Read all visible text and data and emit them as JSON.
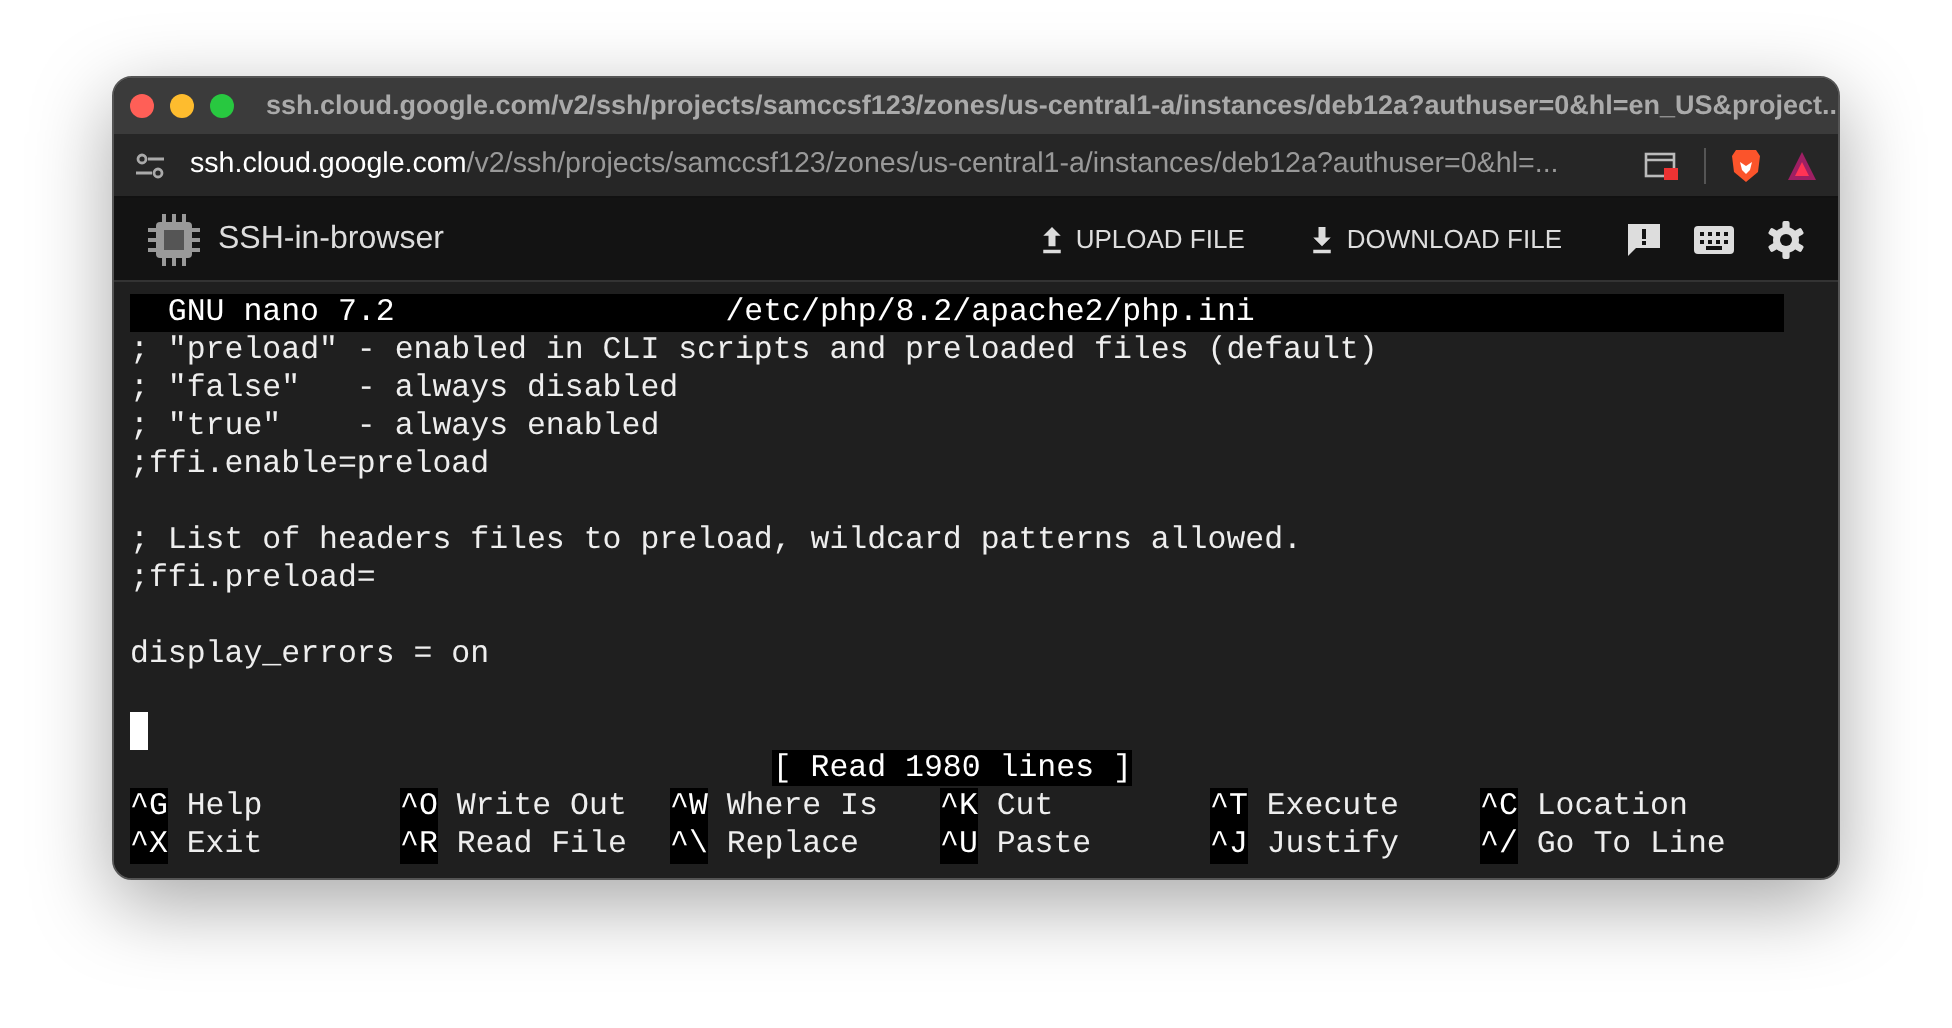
{
  "window": {
    "title": "ssh.cloud.google.com/v2/ssh/projects/samccsf123/zones/us-central1-a/instances/deb12a?authuser=0&hl=en_US&project..."
  },
  "address_bar": {
    "host": "ssh.cloud.google.com",
    "path": "/v2/ssh/projects/samccsf123/zones/us-central1-a/instances/deb12a?authuser=0&hl=..."
  },
  "app": {
    "title": "SSH-in-browser",
    "buttons": [
      {
        "kind": "upload",
        "label": "UPLOAD FILE"
      },
      {
        "kind": "download",
        "label": "DOWNLOAD FILE"
      }
    ]
  },
  "terminal": {
    "header": {
      "app": "GNU nano 7.2",
      "file": "/etc/php/8.2/apache2/php.ini"
    },
    "blocks": [
      [
        "; \"preload\" - enabled in CLI scripts and preloaded files (default)",
        "; \"false\"   - always disabled",
        "; \"true\"    - always enabled",
        ";ffi.enable=preload"
      ],
      [
        "; List of headers files to preload, wildcard patterns allowed.",
        ";ffi.preload="
      ],
      [
        "display_errors = on"
      ]
    ],
    "status": "[ Read 1980 lines ]",
    "shortcuts": [
      [
        {
          "key": "^G",
          "label": "Help"
        },
        {
          "key": "^O",
          "label": "Write Out"
        },
        {
          "key": "^W",
          "label": "Where Is"
        },
        {
          "key": "^K",
          "label": "Cut"
        },
        {
          "key": "^T",
          "label": "Execute"
        },
        {
          "key": "^C",
          "label": "Location"
        }
      ],
      [
        {
          "key": "^X",
          "label": "Exit"
        },
        {
          "key": "^R",
          "label": "Read File"
        },
        {
          "key": "^\\",
          "label": "Replace"
        },
        {
          "key": "^U",
          "label": "Paste"
        },
        {
          "key": "^J",
          "label": "Justify"
        },
        {
          "key": "^/",
          "label": "Go To Line"
        }
      ]
    ]
  }
}
